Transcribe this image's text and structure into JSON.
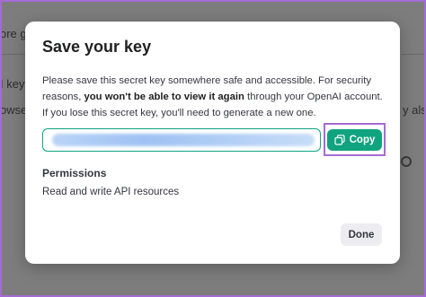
{
  "background": {
    "snippets": [
      "ore g",
      "I keys",
      "owser",
      "y also"
    ]
  },
  "modal": {
    "title": "Save your key",
    "description_part1": "Please save this secret key somewhere safe and accessible. For security reasons, ",
    "description_bold": "you won't be able to view it again",
    "description_part2": " through your OpenAI account. If you lose this secret key, you'll need to generate a new one.",
    "copy_label": "Copy",
    "permissions_title": "Permissions",
    "permissions_value": "Read and write API resources",
    "done_label": "Done"
  },
  "colors": {
    "accent": "#10a37f",
    "highlight": "#a56bd3",
    "overlay": "#7d7d7d"
  },
  "icons": {
    "copy": "copy-icon"
  }
}
